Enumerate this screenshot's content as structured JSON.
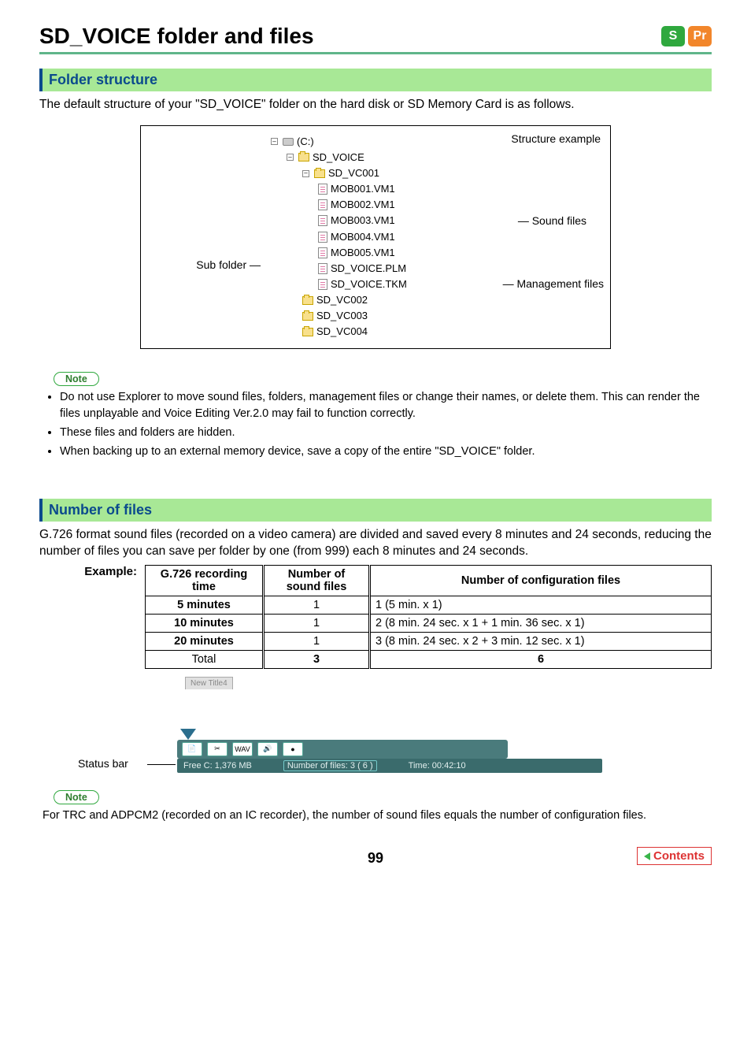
{
  "header": {
    "title": "SD_VOICE folder and files",
    "badge_s": "S",
    "badge_pr": "Pr"
  },
  "section1": {
    "heading": "Folder structure",
    "intro": "The default structure of your \"SD_VOICE\" folder on the hard disk or SD Memory Card is as follows.",
    "example_label": "Structure example",
    "subfolder_label": "Sub folder",
    "sound_files_label": "Sound files",
    "mgmt_files_label": "Management files",
    "tree": {
      "drive": "(C:)",
      "root": "SD_VOICE",
      "sub1": "SD_VC001",
      "files": [
        "MOB001.VM1",
        "MOB002.VM1",
        "MOB003.VM1",
        "MOB004.VM1",
        "MOB005.VM1"
      ],
      "mgmt": [
        "SD_VOICE.PLM",
        "SD_VOICE.TKM"
      ],
      "extra": [
        "SD_VC002",
        "SD_VC003",
        "SD_VC004"
      ]
    }
  },
  "note1": {
    "label": "Note",
    "items": [
      "Do not use Explorer to move sound files, folders, management files or change their names, or delete them. This can render the files unplayable and Voice Editing Ver.2.0 may fail to function correctly.",
      "These files and folders are hidden.",
      "When backing up to an external memory device, save a copy of the entire \"SD_VOICE\" folder."
    ]
  },
  "section2": {
    "heading": "Number of files",
    "intro": "G.726 format sound files (recorded on a video camera) are divided and saved every 8 minutes and 24 seconds, reducing the number of files you can save per folder by one (from 999) each 8 minutes and 24 seconds.",
    "example_label": "Example:",
    "table": {
      "headers": [
        "G.726 recording time",
        "Number of sound files",
        "Number of configuration files"
      ],
      "rows": [
        {
          "c1": "5 minutes",
          "c2": "1",
          "c3": "1 (5 min. x 1)"
        },
        {
          "c1": "10 minutes",
          "c2": "1",
          "c3": "2 (8 min. 24 sec. x 1 + 1 min. 36 sec. x 1)"
        },
        {
          "c1": "20 minutes",
          "c2": "1",
          "c3": "3 (8 min. 24 sec. x 2 + 3 min. 12 sec. x 1)"
        }
      ],
      "total_row": {
        "c1": "Total",
        "c2": "3",
        "c3": "6"
      }
    },
    "status_tab": "New Title4",
    "wav_label": "WAV",
    "status_free": "Free C: 1,376 MB",
    "status_num": "Number of files:  3 ( 6 )",
    "status_time": "Time:  00:42:10",
    "status_bar_label": "Status bar"
  },
  "note2": {
    "label": "Note",
    "text": "For TRC and ADPCM2 (recorded on an IC recorder), the number of sound files equals the number of configuration files."
  },
  "footer": {
    "page_num": "99",
    "contents": "Contents"
  }
}
